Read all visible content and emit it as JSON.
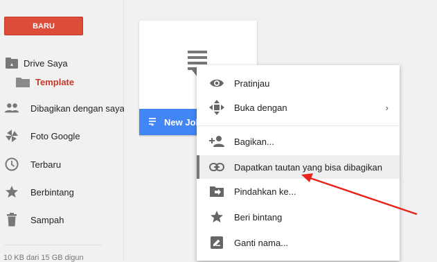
{
  "sidebar": {
    "new_button": "BARU",
    "items": [
      {
        "label": "Drive Saya",
        "icon": "drive-icon"
      },
      {
        "label": "Template",
        "icon": "folder-icon"
      },
      {
        "label": "Dibagikan dengan saya",
        "icon": "people-icon"
      },
      {
        "label": "Foto Google",
        "icon": "photos-icon"
      },
      {
        "label": "Terbaru",
        "icon": "clock-icon"
      },
      {
        "label": "Berbintang",
        "icon": "star-icon"
      },
      {
        "label": "Sampah",
        "icon": "trash-icon"
      }
    ],
    "storage": "10 KB dari 15 GB digun"
  },
  "file_card": {
    "title": "New Jol",
    "icon": "doc-icon"
  },
  "context_menu": {
    "items": [
      {
        "label": "Pratinjau",
        "icon": "eye-icon"
      },
      {
        "label": "Buka dengan",
        "icon": "move-icon",
        "chevron": "›"
      },
      {
        "label": "Bagikan...",
        "icon": "add-person-icon"
      },
      {
        "label": "Dapatkan tautan yang bisa dibagikan",
        "icon": "link-icon"
      },
      {
        "label": "Pindahkan ke...",
        "icon": "move-to-folder-icon"
      },
      {
        "label": "Beri bintang",
        "icon": "star-icon"
      },
      {
        "label": "Ganti nama...",
        "icon": "rename-icon"
      }
    ]
  },
  "colors": {
    "new_button": "#dd4b39",
    "card_bar": "#4285f4",
    "arrow": "#e8231b",
    "active_label": "#c53929"
  }
}
